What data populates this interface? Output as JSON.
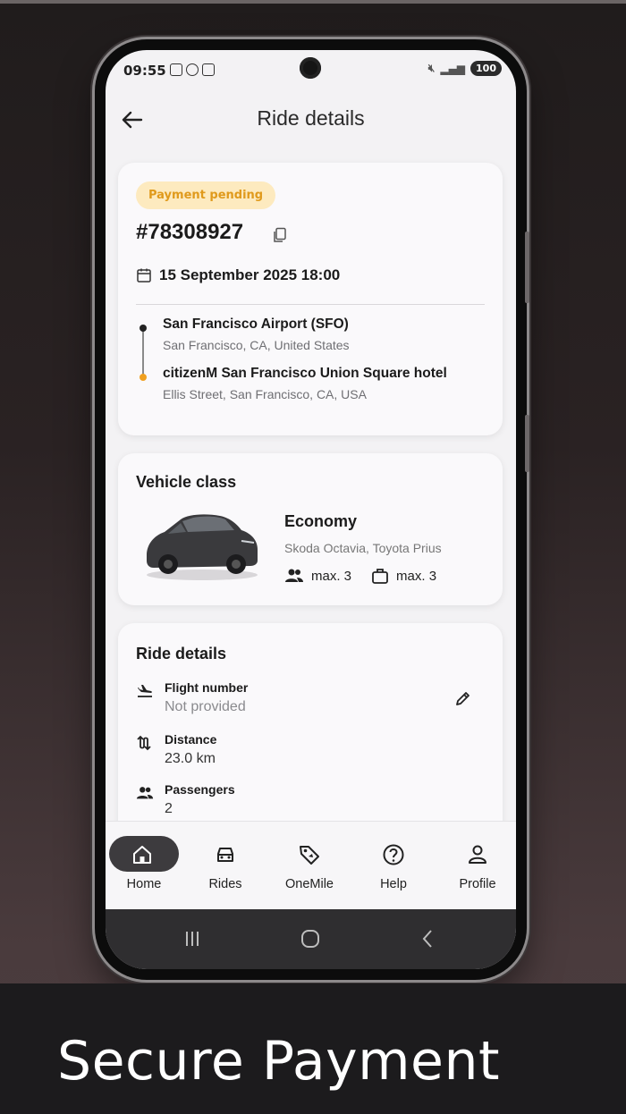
{
  "status_bar": {
    "time": "09:55",
    "battery": "100"
  },
  "header": {
    "title": "Ride details"
  },
  "ride": {
    "status_badge": "Payment pending",
    "ride_id": "#78308927",
    "datetime": "15 September 2025 18:00",
    "pickup": {
      "name": "San Francisco Airport (SFO)",
      "address": "San Francisco, CA, United States"
    },
    "dropoff": {
      "name": "citizenM San Francisco Union Square hotel",
      "address": "Ellis Street, San Francisco, CA, USA"
    }
  },
  "vehicle": {
    "section_title": "Vehicle class",
    "class_name": "Economy",
    "models": "Skoda Octavia, Toyota Prius",
    "passengers_capacity": "max. 3",
    "luggage_capacity": "max. 3"
  },
  "details": {
    "section_title": "Ride details",
    "flight_label": "Flight number",
    "flight_value": "Not provided",
    "distance_label": "Distance",
    "distance_value": "23.0 km",
    "passengers_label": "Passengers",
    "passengers_value": "2"
  },
  "bottom_nav": {
    "items": [
      {
        "label": "Home",
        "icon": "home-icon",
        "active": true
      },
      {
        "label": "Rides",
        "icon": "car-icon",
        "active": false
      },
      {
        "label": "OneMile",
        "icon": "tag-icon",
        "active": false
      },
      {
        "label": "Help",
        "icon": "help-icon",
        "active": false
      },
      {
        "label": "Profile",
        "icon": "profile-icon",
        "active": false
      }
    ]
  },
  "caption": "Secure Payment",
  "colors": {
    "badge_bg": "#fdeabf",
    "badge_text": "#e09a1c",
    "dropoff_dot": "#f0a020",
    "nav_active": "#3d3b3e"
  }
}
